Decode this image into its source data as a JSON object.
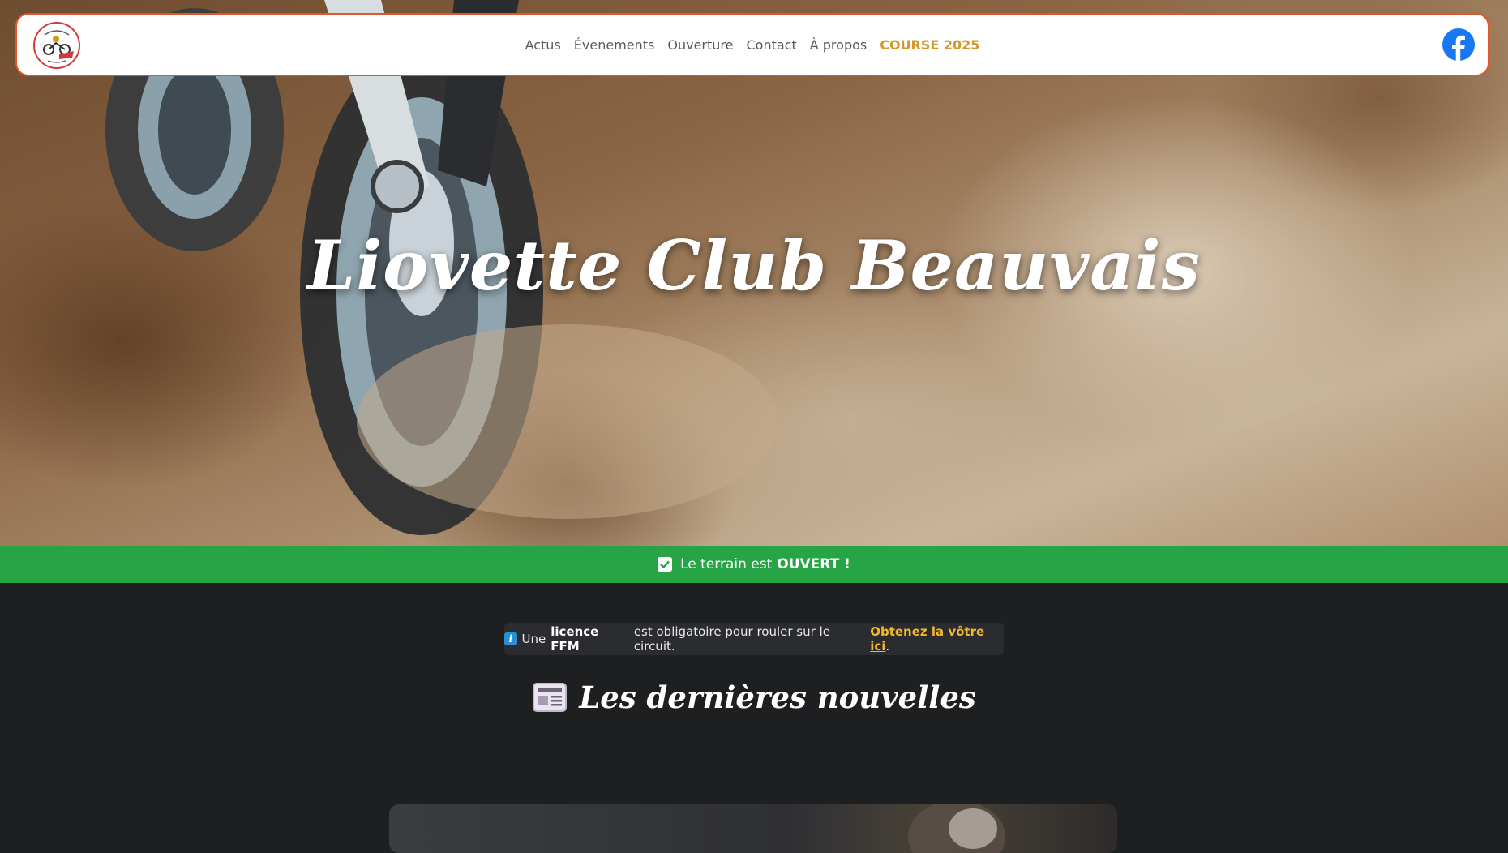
{
  "navbar": {
    "logo_alt": "Liovette Moto Club Beauvais",
    "links": [
      {
        "label": "Actus"
      },
      {
        "label": "Évenements"
      },
      {
        "label": "Ouverture"
      },
      {
        "label": "Contact"
      },
      {
        "label": "À propos"
      },
      {
        "label": "COURSE 2025"
      }
    ],
    "facebook_icon": "facebook-icon"
  },
  "hero": {
    "title": "Liovette Club Beauvais"
  },
  "status": {
    "icon": "check-icon",
    "prefix": "Le terrain est",
    "state": "OUVERT !",
    "color": "#27a546"
  },
  "info": {
    "icon": "info-icon",
    "text_before": "Une",
    "bold": "licence FFM",
    "text_after": "est obligatoire pour rouler sur le circuit.",
    "link_label": "Obtenez la vôtre ici",
    "suffix": "."
  },
  "news": {
    "icon": "newspaper-icon",
    "title": "Les dernières nouvelles"
  },
  "colors": {
    "accent_border": "#e0552c",
    "highlight_link": "#d39a2a",
    "info_link": "#f0b72a",
    "page_background": "#1e1f21"
  }
}
